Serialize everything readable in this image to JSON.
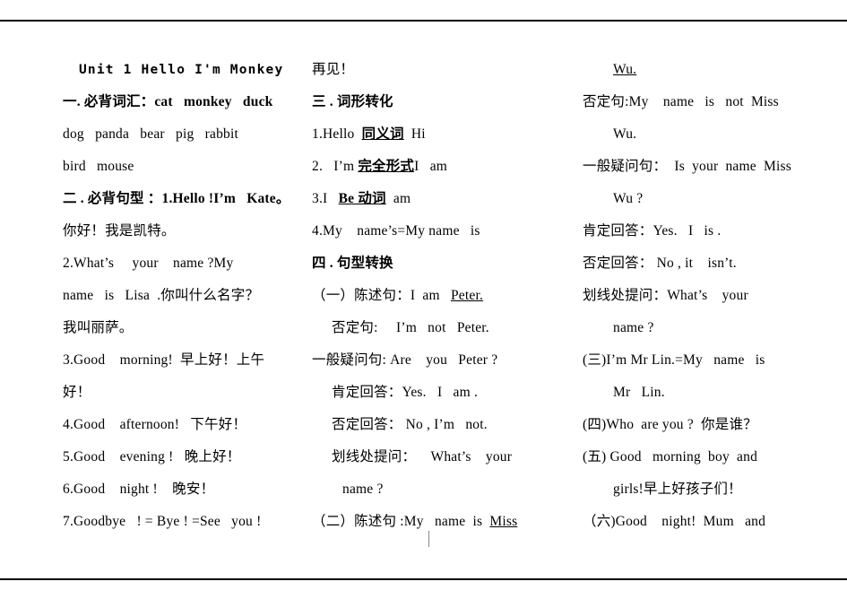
{
  "document": {
    "title_line": "Unit 1  Hello  I'm  Monkey",
    "column1": [
      {
        "id": "c1l1",
        "text": "一. 必背词汇：cat   monkey   duck"
      },
      {
        "id": "c1l2",
        "text": "dog   panda   bear   pig   rabbit"
      },
      {
        "id": "c1l3",
        "text": "bird   mouse"
      },
      {
        "id": "c1l4",
        "text": "二 . 必背句型 ：1.Hello !I’m   Kate。"
      },
      {
        "id": "c1l5",
        "text": "你好！我是凯特。"
      },
      {
        "id": "c1l6",
        "text": "2.What’s     your    name ?My"
      },
      {
        "id": "c1l7",
        "text": "name   is   Lisa  .你叫什么名字？"
      },
      {
        "id": "c1l8",
        "text": "我叫丽萨。"
      },
      {
        "id": "c1l9",
        "text": "3.Good    morning!  早上好！上午"
      },
      {
        "id": "c1l10",
        "text": "好！"
      },
      {
        "id": "c1l11",
        "text": "4.Good    afternoon!   下午好！"
      },
      {
        "id": "c1l12",
        "text": "5.Good    evening !   晚上好！"
      },
      {
        "id": "c1l13",
        "text": "6.Good    night !    晚安！"
      },
      {
        "id": "c1l14",
        "text": "7.Goodbye   ! = Bye ! =See   you !"
      }
    ],
    "column2": [
      {
        "id": "c2l1",
        "text": "再见！"
      },
      {
        "id": "c2l2",
        "text": "三 . 词形转化"
      },
      {
        "id": "c2l3",
        "text": "1.Hello  同义词  Hi"
      },
      {
        "id": "c2l4",
        "text": "2.   I’m 完全形式I   am"
      },
      {
        "id": "c2l5",
        "text": "3.I   Be 动词  am"
      },
      {
        "id": "c2l6",
        "text": "4.My    name’s=My name   is"
      },
      {
        "id": "c2l7",
        "text": "四 . 句型转换"
      },
      {
        "id": "c2l8",
        "text": "（一）陈述句：I  am   Peter."
      },
      {
        "id": "c2l9",
        "text": "否定句:     I’m   not   Peter."
      },
      {
        "id": "c2l10",
        "text": "一般疑问句: Are    you   Peter ?"
      },
      {
        "id": "c2l11",
        "text": "肯定回答：Yes.   I   am ."
      },
      {
        "id": "c2l12",
        "text": "否定回答： No , I’m   not."
      },
      {
        "id": "c2l13",
        "text": "划线处提问：    What’s    your"
      },
      {
        "id": "c2l14",
        "text": "name ?"
      },
      {
        "id": "c2l15",
        "text": "（二）陈述句 :My   name  is  Miss"
      }
    ],
    "column3": [
      {
        "id": "c3l1",
        "text": "Wu."
      },
      {
        "id": "c3l2",
        "text": "否定句:My    name   is   not  Miss"
      },
      {
        "id": "c3l3",
        "text": "Wu."
      },
      {
        "id": "c3l4",
        "text": "一般疑问句：  Is  your  name  Miss"
      },
      {
        "id": "c3l5",
        "text": "Wu ?"
      },
      {
        "id": "c3l6",
        "text": "肯定回答：Yes.   I   is ."
      },
      {
        "id": "c3l7",
        "text": "否定回答： No , it    isn’t."
      },
      {
        "id": "c3l8",
        "text": "划线处提问：What’s    your"
      },
      {
        "id": "c3l9",
        "text": "name ?"
      },
      {
        "id": "c3l10",
        "text": "(三)I’m Mr Lin.=My   name   is"
      },
      {
        "id": "c3l11",
        "text": "Mr   Lin."
      },
      {
        "id": "c3l12",
        "text": "(四)Who  are you ?  你是谁？"
      },
      {
        "id": "c3l13",
        "text": "(五) Good   morning  boy  and"
      },
      {
        "id": "c3l14",
        "text": "girls!早上好孩子们！"
      },
      {
        "id": "c3l15",
        "text": "（六)Good    night!  Mum   and"
      }
    ]
  }
}
